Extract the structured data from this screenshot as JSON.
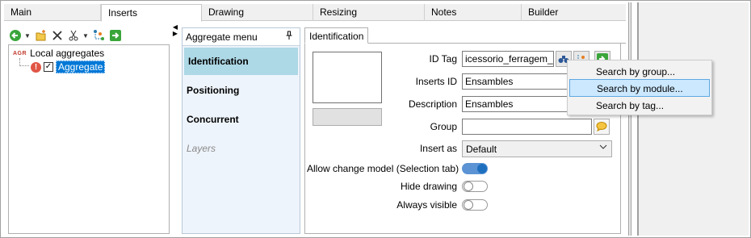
{
  "tabs": [
    {
      "label": "Main",
      "active": false
    },
    {
      "label": "Inserts",
      "active": true
    },
    {
      "label": "Drawing",
      "active": false
    },
    {
      "label": "Resizing",
      "active": false
    },
    {
      "label": "Notes",
      "active": false
    },
    {
      "label": "Builder",
      "active": false
    }
  ],
  "toolbar": {
    "icons": [
      "back-green-icon",
      "dropdown-arrow",
      "new-folder-icon",
      "delete-x-icon",
      "scissors-icon",
      "dropdown-arrow",
      "tree-link-icon",
      "export-green-icon"
    ]
  },
  "tree": {
    "root": {
      "badge": "AGR",
      "label": "Local aggregates"
    },
    "child": {
      "label": "Aggregate",
      "checked": true,
      "has_error": true
    }
  },
  "aggregate_menu": {
    "title": "Aggregate menu",
    "items": [
      {
        "label": "Identification",
        "selected": true,
        "disabled": false
      },
      {
        "label": "Positioning",
        "selected": false,
        "disabled": false
      },
      {
        "label": "Concurrent",
        "selected": false,
        "disabled": false
      },
      {
        "label": "Layers",
        "selected": false,
        "disabled": true
      }
    ]
  },
  "content": {
    "tab_label": "Identification",
    "id_tag": {
      "label": "ID Tag",
      "value": "icessorio_ferragem_a"
    },
    "inserts_id": {
      "label": "Inserts ID",
      "value": "Ensambles"
    },
    "description": {
      "label": "Description",
      "value": "Ensambles"
    },
    "group": {
      "label": "Group",
      "value": ""
    },
    "insert_as": {
      "label": "Insert as",
      "value": "Default"
    },
    "toggles": [
      {
        "label": "Allow change model (Selection tab)",
        "on": true
      },
      {
        "label": "Hide drawing",
        "on": false
      },
      {
        "label": "Always visible",
        "on": false
      }
    ]
  },
  "popup_menu": {
    "items": [
      {
        "label": "Search by group...",
        "hover": false
      },
      {
        "label": "Search by module...",
        "hover": true
      },
      {
        "label": "Search by tag...",
        "hover": false
      }
    ]
  },
  "colors": {
    "selection_blue": "#0078d7",
    "menu_selected": "#add8e6",
    "toggle_on": "#1f6fbf",
    "popup_hover": "#cce8ff"
  }
}
